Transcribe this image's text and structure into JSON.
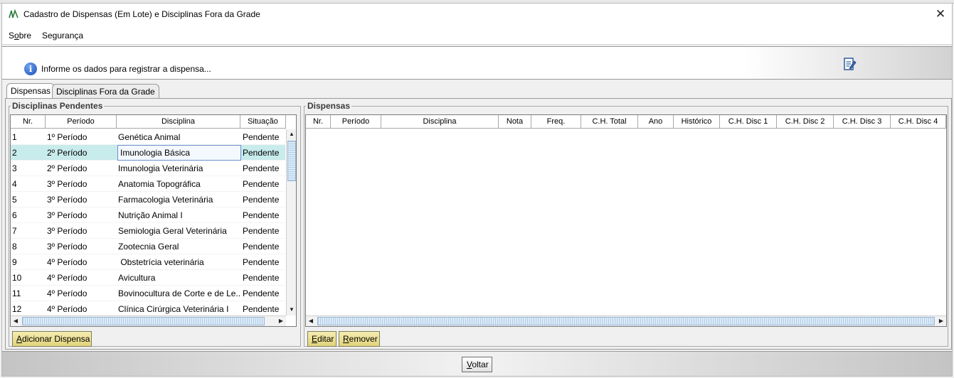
{
  "window": {
    "title": "Cadastro de Dispensas (Em Lote) e Disciplinas Fora da Grade",
    "close_glyph": "✕",
    "app_icon": "app-logo-icon"
  },
  "menu": {
    "sobre_prefix": "S",
    "sobre_mnemonic": "o",
    "sobre_suffix": "bre",
    "seguranca": "Segurança"
  },
  "banner": {
    "info_glyph": "i",
    "message": "Informe os dados para registrar a dispensa...",
    "icon_name": "edit-document-icon"
  },
  "tabs": {
    "dispensas": "Dispensas",
    "fora_da_grade": "Disciplinas Fora da Grade",
    "active": "Dispensas"
  },
  "pendentes": {
    "title": "Disciplinas Pendentes",
    "headers": {
      "nr": "Nr.",
      "periodo": "Período",
      "disciplina": "Disciplina",
      "situacao": "Situação"
    },
    "rows": [
      {
        "nr": "1",
        "periodo": "1º Período",
        "disciplina": "Genética Animal",
        "situacao": "Pendente"
      },
      {
        "nr": "2",
        "periodo": "2º Período",
        "disciplina": "Imunologia Básica",
        "situacao": "Pendente"
      },
      {
        "nr": "3",
        "periodo": "2º Período",
        "disciplina": "Imunologia Veterinária",
        "situacao": "Pendente"
      },
      {
        "nr": "4",
        "periodo": "3º Período",
        "disciplina": "Anatomia Topográfica",
        "situacao": "Pendente"
      },
      {
        "nr": "5",
        "periodo": "3º Período",
        "disciplina": "Farmacologia Veterinária",
        "situacao": "Pendente"
      },
      {
        "nr": "6",
        "periodo": "3º Período",
        "disciplina": "Nutrição Animal I",
        "situacao": "Pendente"
      },
      {
        "nr": "7",
        "periodo": "3º Período",
        "disciplina": "Semiologia Geral Veterinária",
        "situacao": "Pendente"
      },
      {
        "nr": "8",
        "periodo": "3º Período",
        "disciplina": "Zootecnia Geral",
        "situacao": "Pendente"
      },
      {
        "nr": "9",
        "periodo": "4º Período",
        "disciplina": " Obstetrícia veterinária",
        "situacao": "Pendente"
      },
      {
        "nr": "10",
        "periodo": "4º Período",
        "disciplina": "Avicultura",
        "situacao": "Pendente"
      },
      {
        "nr": "11",
        "periodo": "4º Período",
        "disciplina": "Bovinocultura de Corte e de Le...",
        "situacao": "Pendente"
      },
      {
        "nr": "12",
        "periodo": "4º Período",
        "disciplina": "Clínica Cirúrgica Veterinária I",
        "situacao": "Pendente"
      }
    ],
    "selected_row": 2,
    "button_mnemonic": "A",
    "button_rest": "dicionar Dispensa"
  },
  "dispensas": {
    "title": "Dispensas",
    "headers": [
      "Nr.",
      "Período",
      "Disciplina",
      "Nota",
      "Freq.",
      "C.H. Total",
      "Ano",
      "Histórico",
      "C.H. Disc 1",
      "C.H. Disc 2",
      "C.H. Disc 3",
      "C.H. Disc 4"
    ],
    "rows": [],
    "editar_mnemonic": "E",
    "editar_rest": "ditar",
    "remover_mnemonic": "R",
    "remover_rest": "emover"
  },
  "footer": {
    "voltar_mnemonic": "V",
    "voltar_rest": "oltar"
  },
  "colors": {
    "button_gold": "#e8da88",
    "selected_row": "#c8ebeb",
    "info_blue": "#1d4fb3"
  }
}
